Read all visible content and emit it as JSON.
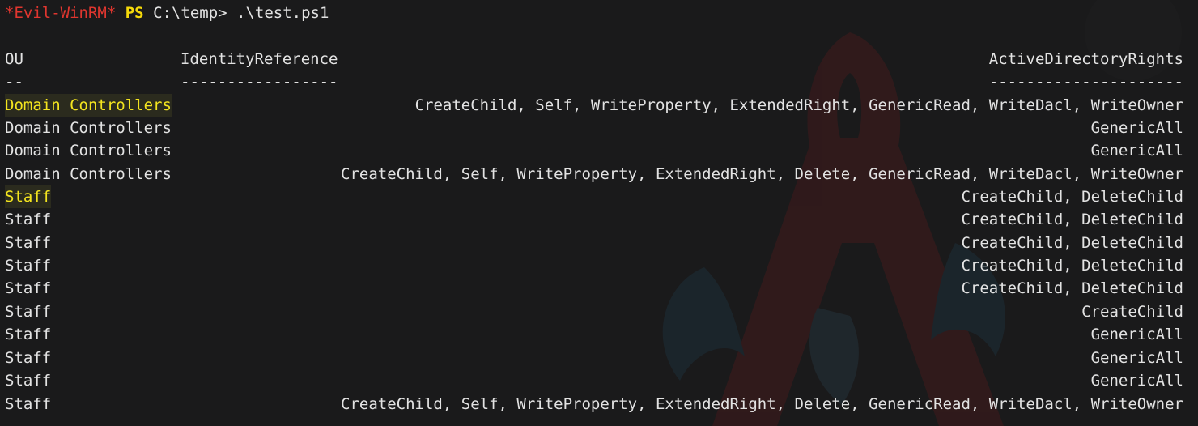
{
  "prompt": {
    "shell": "*Evil-WinRM*",
    "ps": "PS",
    "cwd_command": "C:\\temp> .\\test.ps1"
  },
  "table": {
    "headers": {
      "ou": "OU",
      "identity": "IdentityReference",
      "rights": "ActiveDirectoryRights"
    },
    "separators": {
      "ou": "--",
      "identity": "-----------------",
      "rights": "---------------------"
    },
    "rows": [
      {
        "ou": "Domain Controllers",
        "identity": "",
        "rights": "CreateChild, Self, WriteProperty, ExtendedRight, GenericRead, WriteDacl, WriteOwner",
        "highlight": true
      },
      {
        "ou": "Domain Controllers",
        "identity": "",
        "rights": "GenericAll",
        "highlight": false
      },
      {
        "ou": "Domain Controllers",
        "identity": "",
        "rights": "GenericAll",
        "highlight": false
      },
      {
        "ou": "Domain Controllers",
        "identity": "",
        "rights": "CreateChild, Self, WriteProperty, ExtendedRight, Delete, GenericRead, WriteDacl, WriteOwner",
        "highlight": false
      },
      {
        "ou": "Staff",
        "identity": "",
        "rights": "CreateChild, DeleteChild",
        "highlight": true
      },
      {
        "ou": "Staff",
        "identity": "",
        "rights": "CreateChild, DeleteChild",
        "highlight": false
      },
      {
        "ou": "Staff",
        "identity": "",
        "rights": "CreateChild, DeleteChild",
        "highlight": false
      },
      {
        "ou": "Staff",
        "identity": "",
        "rights": "CreateChild, DeleteChild",
        "highlight": false
      },
      {
        "ou": "Staff",
        "identity": "",
        "rights": "CreateChild, DeleteChild",
        "highlight": false
      },
      {
        "ou": "Staff",
        "identity": "",
        "rights": "CreateChild",
        "highlight": false
      },
      {
        "ou": "Staff",
        "identity": "",
        "rights": "GenericAll",
        "highlight": false
      },
      {
        "ou": "Staff",
        "identity": "",
        "rights": "GenericAll",
        "highlight": false
      },
      {
        "ou": "Staff",
        "identity": "",
        "rights": "GenericAll",
        "highlight": false
      },
      {
        "ou": "Staff",
        "identity": "",
        "rights": "CreateChild, Self, WriteProperty, ExtendedRight, Delete, GenericRead, WriteDacl, WriteOwner",
        "highlight": false
      }
    ]
  },
  "colors": {
    "background": "#1a1a1b",
    "text": "#e3e3e3",
    "evil": "#e0362f",
    "ps": "#f5d90a",
    "highlight_text": "#f4e51f",
    "highlight_bg": "#2b2b1e"
  }
}
